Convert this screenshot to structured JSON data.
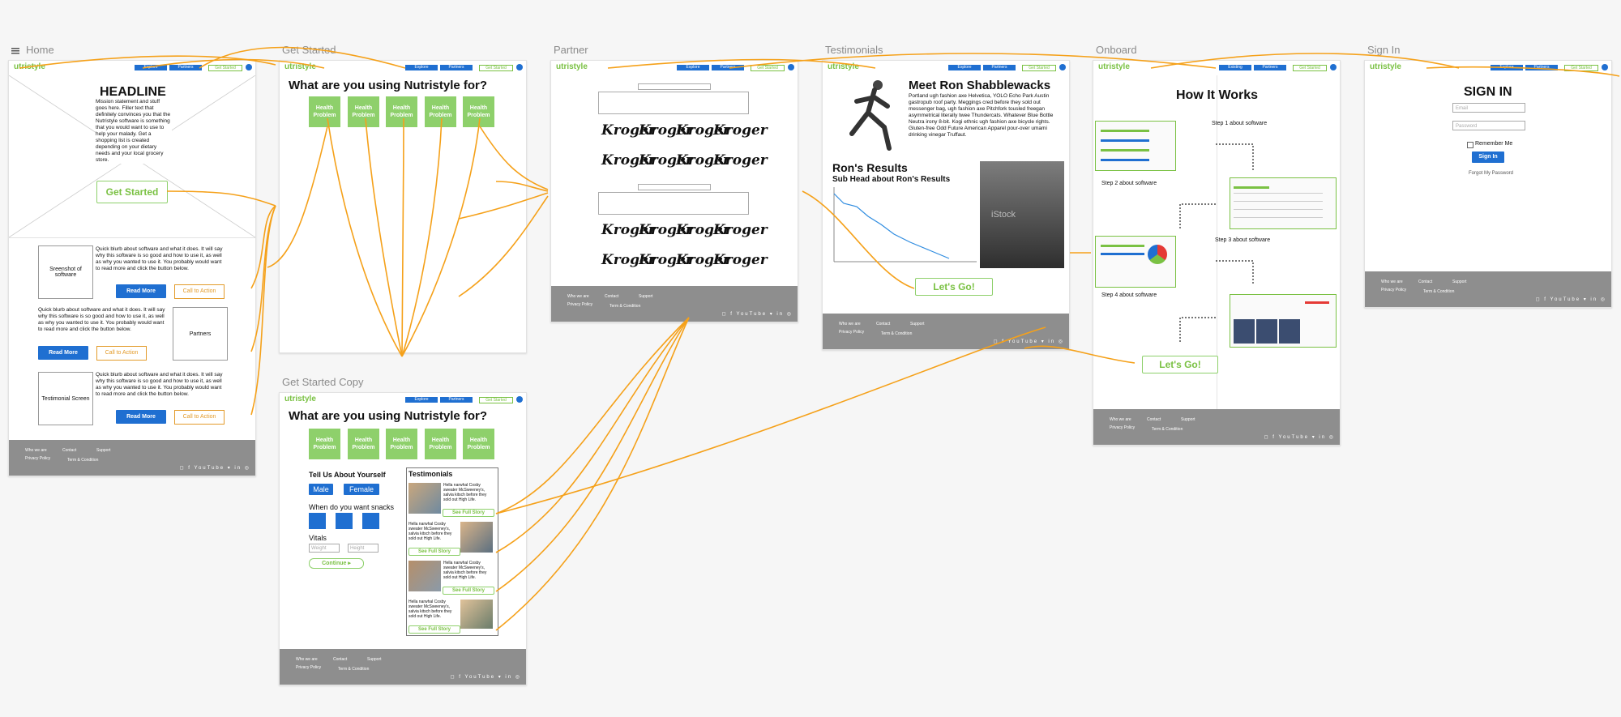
{
  "colors": {
    "accent": "#7ac143",
    "blue": "#1f6fd1",
    "connector": "#f5a11a",
    "footer": "#8e8e8e"
  },
  "canvas": {
    "toolbar_icon": "list-icon"
  },
  "boards": {
    "home": "Home",
    "get_started": "Get Started",
    "partner": "Partner",
    "testimonials": "Testimonials",
    "onboard": "Onboard",
    "sign_in": "Sign In",
    "get_started_copy": "Get Started Copy"
  },
  "nav": {
    "logo": "Nutristyle",
    "logo_cut": "utristyle",
    "explore": "Explore",
    "partners": "Partners",
    "get_started": "Get Started",
    "existing": "Existing"
  },
  "footer": {
    "who": "Who we are",
    "contact": "Contact",
    "support": "Support",
    "privacy": "Privacy Policy",
    "terms": "Term & Condition",
    "icons": "◻ f YouTube ▾ in ◎"
  },
  "home": {
    "headline": "HEADLINE",
    "mission": "Mission statement and stuff goes here. Filler text that definitely convinces you that the Nutristyle software is something that you would want to use to help your malady. Get a shopping list is created depending on your dietary needs and your local grocery store.",
    "get_started": "Get Started",
    "screenshot": "Sreenshot of software",
    "partners": "Partners",
    "testimonial": "Testimonial Screen",
    "blurb": "Quick blurb about software and what it does. It will say why this software is so good and how to use it, as well as why you wanted to use it. You probably would want to read more and click the button below.",
    "read_more": "Read More",
    "cta": "Call to Action"
  },
  "get_started": {
    "question": "What are you using Nutristyle for?",
    "health": "Health Problem"
  },
  "gsc": {
    "tell": "Tell Us About Yourself",
    "male": "Male",
    "female": "Female",
    "snacks": "When do you want snacks",
    "vitals": "Vitals",
    "weight": "Weight",
    "height": "Height",
    "continue": "Continue  ▸",
    "testimonials": "Testimonials",
    "hipster": "Hella narwhal Cosby sweater McSweeney's, salvia kitsch before they sold out High Life.",
    "see_full": "See Full Story"
  },
  "partner": {
    "brand": "Kroger"
  },
  "testimonials": {
    "meet": "Meet Ron Shabblewacks",
    "bio": "Portland ugh fashion axe Helvetica, YOLO Echo Park Austin gastropub roof party. Meggings cred before they sold out messenger bag, ugh fashion axe Pitchfork tousled freegan asymmetrical literally twee Thundercats. Whatever Blue Bottle Neutra irony 8-bit. Kogi ethnic ugh fashion axe bicycle rights. Gluten-free Odd Future American Apparel pour-over umami drinking vinegar Truffaut.",
    "results": "Ron's Results",
    "subhead": "Sub Head about Ron's Results",
    "lets_go": "Let's Go!",
    "stock": "iStock"
  },
  "onboard": {
    "title": "How It Works",
    "step1": "Step 1 about software",
    "step2": "Step 2 about software",
    "step3": "Step 3 about software",
    "step4": "Step 4 about software",
    "lets_go": "Let's Go!"
  },
  "sign_in": {
    "title": "SIGN IN",
    "email": "Email",
    "password": "Password",
    "remember": "Remember Me",
    "sign_in": "Sign In",
    "forgot": "Forgot My Password"
  }
}
